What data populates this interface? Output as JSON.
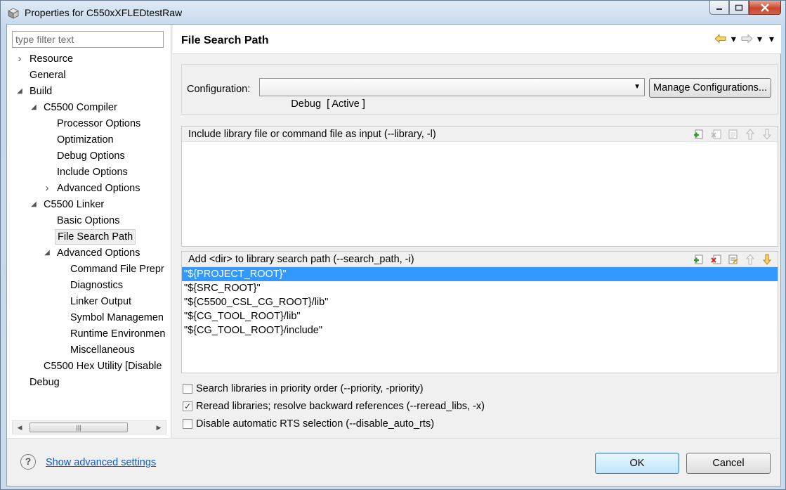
{
  "window": {
    "title": "Properties for C550xXFLEDtestRaw",
    "controls": [
      "minimize",
      "maximize",
      "close"
    ]
  },
  "filter": {
    "placeholder": "type filter text",
    "value": ""
  },
  "tree": [
    {
      "label": "Resource",
      "indent": 0,
      "twisty": "collapsed"
    },
    {
      "label": "General",
      "indent": 0,
      "twisty": "none"
    },
    {
      "label": "Build",
      "indent": 0,
      "twisty": "expanded"
    },
    {
      "label": "C5500 Compiler",
      "indent": 1,
      "twisty": "expanded"
    },
    {
      "label": "Processor Options",
      "indent": 2,
      "twisty": "none"
    },
    {
      "label": "Optimization",
      "indent": 2,
      "twisty": "none"
    },
    {
      "label": "Debug Options",
      "indent": 2,
      "twisty": "none"
    },
    {
      "label": "Include Options",
      "indent": 2,
      "twisty": "none"
    },
    {
      "label": "Advanced Options",
      "indent": 2,
      "twisty": "collapsed"
    },
    {
      "label": "C5500 Linker",
      "indent": 1,
      "twisty": "expanded"
    },
    {
      "label": "Basic Options",
      "indent": 2,
      "twisty": "none"
    },
    {
      "label": "File Search Path",
      "indent": 2,
      "twisty": "none",
      "selected": true
    },
    {
      "label": "Advanced Options",
      "indent": 2,
      "twisty": "expanded"
    },
    {
      "label": "Command File Prepr",
      "indent": 3,
      "twisty": "none"
    },
    {
      "label": "Diagnostics",
      "indent": 3,
      "twisty": "none"
    },
    {
      "label": "Linker Output",
      "indent": 3,
      "twisty": "none"
    },
    {
      "label": "Symbol Managemen",
      "indent": 3,
      "twisty": "none"
    },
    {
      "label": "Runtime Environmen",
      "indent": 3,
      "twisty": "none"
    },
    {
      "label": "Miscellaneous",
      "indent": 3,
      "twisty": "none"
    },
    {
      "label": "C5500 Hex Utility  [Disable",
      "indent": 1,
      "twisty": "none"
    },
    {
      "label": "Debug",
      "indent": 0,
      "twisty": "none"
    }
  ],
  "page": {
    "title": "File Search Path",
    "configuration_label": "Configuration:",
    "configuration_value": "Debug  [ Active ]",
    "manage_button": "Manage Configurations..."
  },
  "library_section": {
    "header": "Include library file or command file as input (--library, -l)",
    "items": []
  },
  "search_path_section": {
    "header": "Add <dir> to library search path (--search_path, -i)",
    "items": [
      "\"${PROJECT_ROOT}\"",
      "\"${SRC_ROOT}\"",
      "\"${C5500_CSL_CG_ROOT}/lib\"",
      "\"${CG_TOOL_ROOT}/lib\"",
      "\"${CG_TOOL_ROOT}/include\""
    ],
    "selected_index": 0
  },
  "options": [
    {
      "label": "Search libraries in priority order (--priority, -priority)",
      "checked": false
    },
    {
      "label": "Reread libraries; resolve backward references (--reread_libs, -x)",
      "checked": true
    },
    {
      "label": "Disable automatic RTS selection (--disable_auto_rts)",
      "checked": false
    }
  ],
  "footer": {
    "advanced_link": "Show advanced settings",
    "ok": "OK",
    "cancel": "Cancel"
  },
  "colors": {
    "selection": "#3399ff",
    "link": "#0a59c8"
  }
}
